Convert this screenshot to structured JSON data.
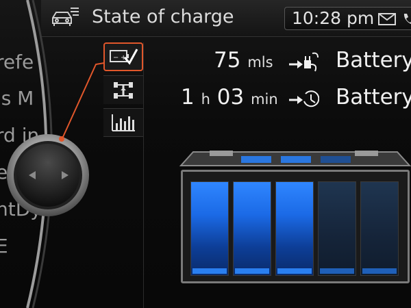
{
  "header": {
    "title": "State of charge",
    "time": "10:28 pm",
    "icons": [
      "car-menu-icon",
      "mail-icon",
      "phone-icon"
    ]
  },
  "left_menu": {
    "items": [
      "refe",
      "'s M",
      "rd in",
      "e",
      "ntDy",
      "E"
    ]
  },
  "tools": [
    {
      "name": "charge-check",
      "icon": "battery-check-icon",
      "selected": true
    },
    {
      "name": "drive-train",
      "icon": "drivetrain-icon",
      "selected": false
    },
    {
      "name": "statistics",
      "icon": "bar-chart-icon",
      "selected": false
    }
  ],
  "rows": {
    "range": {
      "value": "75",
      "unit": "mls",
      "icon": "plug-arrow-icon",
      "label": "Battery"
    },
    "time": {
      "hours": "1",
      "hours_unit": "h",
      "minutes": "03",
      "minutes_unit": "min",
      "icon": "timer-arrow-icon",
      "label": "Battery"
    }
  },
  "battery": {
    "cells_total": 5,
    "cells_filled": 3,
    "charge_fraction": 0.6
  },
  "colors": {
    "accent": "#e1572b",
    "cell_on": "#2f86ff",
    "cell_off": "#1f3550"
  }
}
